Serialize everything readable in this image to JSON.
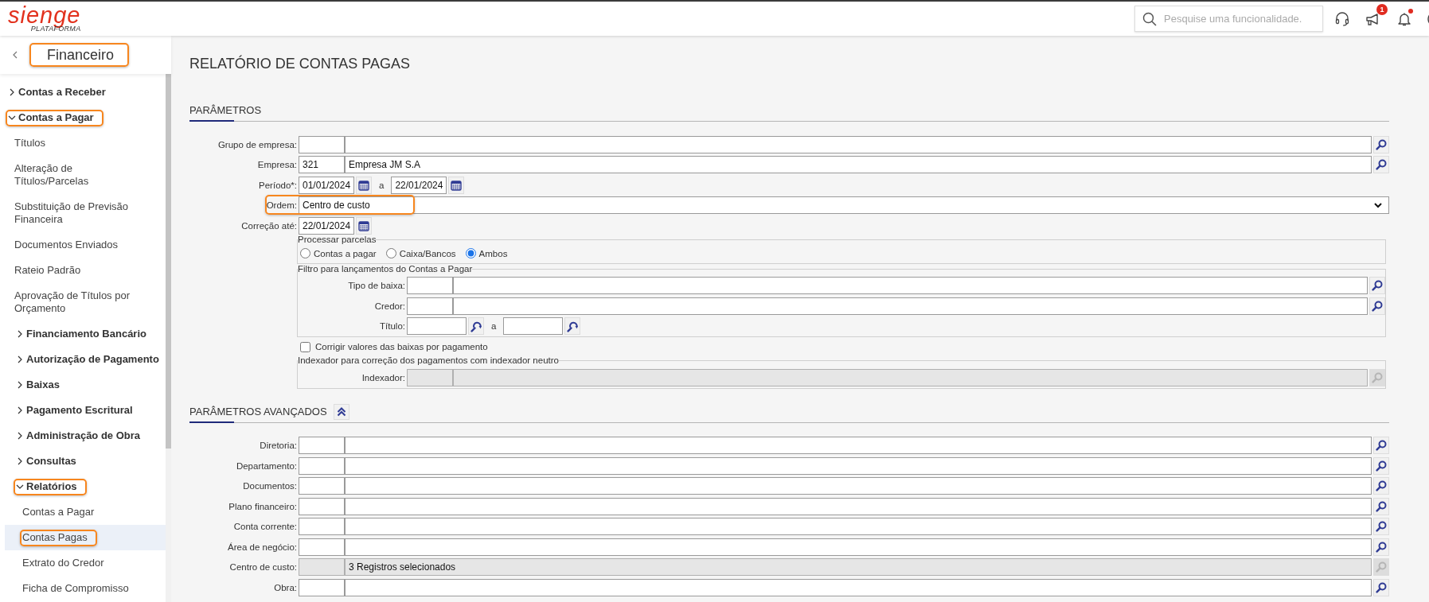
{
  "header": {
    "logo": "sienge",
    "logo_subtitle": "PLATAFORMA",
    "search": {
      "placeholder": "Pesquise uma funcionalidade."
    },
    "announcements_badge": "1",
    "unread_notifications": true
  },
  "sidebar": {
    "title": "Financeiro",
    "title_highlighted": true,
    "items": [
      {
        "label": "Contas a Receber",
        "kind": "group",
        "expanded": false,
        "selected": false,
        "highlighted": false
      },
      {
        "label": "Contas a Pagar",
        "kind": "group",
        "expanded": true,
        "selected": false,
        "highlighted": true,
        "children": [
          {
            "label": "Títulos",
            "kind": "link",
            "selected": false,
            "highlighted": false
          },
          {
            "label": "Alteração de Títulos/Parcelas",
            "kind": "link",
            "selected": false,
            "highlighted": false
          },
          {
            "label": "Substituição de Previsão Financeira",
            "kind": "link",
            "selected": false,
            "highlighted": false
          },
          {
            "label": "Documentos Enviados",
            "kind": "link",
            "selected": false,
            "highlighted": false
          },
          {
            "label": "Rateio Padrão",
            "kind": "link",
            "selected": false,
            "highlighted": false
          },
          {
            "label": "Aprovação de Títulos por Orçamento",
            "kind": "link",
            "selected": false,
            "highlighted": false
          },
          {
            "label": "Financiamento Bancário",
            "kind": "group",
            "expanded": false,
            "selected": false,
            "highlighted": false
          },
          {
            "label": "Autorização de Pagamento",
            "kind": "group",
            "expanded": false,
            "selected": false,
            "highlighted": false
          },
          {
            "label": "Baixas",
            "kind": "group",
            "expanded": false,
            "selected": false,
            "highlighted": false
          },
          {
            "label": "Pagamento Escritural",
            "kind": "group",
            "expanded": false,
            "selected": false,
            "highlighted": false
          },
          {
            "label": "Administração de Obra",
            "kind": "group",
            "expanded": false,
            "selected": false,
            "highlighted": false
          },
          {
            "label": "Consultas",
            "kind": "group",
            "expanded": false,
            "selected": false,
            "highlighted": false
          },
          {
            "label": "Relatórios",
            "kind": "group",
            "expanded": true,
            "selected": false,
            "highlighted": true,
            "children": [
              {
                "label": "Contas a Pagar",
                "kind": "link",
                "selected": false,
                "highlighted": false
              },
              {
                "label": "Contas Pagas",
                "kind": "link",
                "selected": true,
                "highlighted": true
              },
              {
                "label": "Extrato do Credor",
                "kind": "link",
                "selected": false,
                "highlighted": false
              },
              {
                "label": "Ficha de Compromisso",
                "kind": "link",
                "selected": false,
                "highlighted": false
              }
            ]
          }
        ]
      }
    ]
  },
  "page_title": "RELATÓRIO DE CONTAS PAGAS",
  "parameters": {
    "title": "PARÂMETROS",
    "items": [
      {
        "kind": "lookup",
        "label": "Grupo de empresa:",
        "disabled": false
      },
      {
        "kind": "lookup",
        "label": "Empresa:",
        "code": "321",
        "description": "Empresa JM S.A",
        "disabled": false
      },
      {
        "kind": "date_range",
        "label": "Período*:",
        "from": "01/01/2024",
        "separator": "a",
        "to": "22/01/2024"
      },
      {
        "kind": "select",
        "label": "Ordem:",
        "value": "Centro de custo",
        "highlighted": true
      },
      {
        "kind": "date",
        "label": "Correção até:",
        "value": "22/01/2024"
      },
      {
        "kind": "fieldset",
        "legend": "Processar parcelas",
        "items": [
          {
            "kind": "radios",
            "options": [
              {
                "label": "Contas a pagar",
                "selected": false
              },
              {
                "label": "Caixa/Bancos",
                "selected": false
              },
              {
                "label": "Ambos",
                "selected": true
              }
            ]
          }
        ]
      },
      {
        "kind": "fieldset",
        "legend": "Filtro para lançamentos do Contas a Pagar",
        "items": [
          {
            "kind": "lookup",
            "label": "Tipo de baixa:",
            "disabled": false
          },
          {
            "kind": "lookup",
            "label": "Credor:",
            "disabled": false
          },
          {
            "kind": "range",
            "label": "Título:",
            "separator": "a"
          }
        ]
      },
      {
        "kind": "checkbox",
        "label": "Corrigir valores das baixas por pagamento",
        "checked": false
      },
      {
        "kind": "fieldset",
        "legend": "Indexador para correção dos pagamentos com indexador neutro",
        "items": [
          {
            "kind": "lookup",
            "label": "Indexador:",
            "disabled": true
          }
        ]
      }
    ]
  },
  "advanced_parameters": {
    "title": "PARÂMETROS AVANÇADOS",
    "expanded": true,
    "items": [
      {
        "kind": "lookup",
        "label": "Diretoria:",
        "disabled": false
      },
      {
        "kind": "lookup",
        "label": "Departamento:",
        "disabled": false
      },
      {
        "kind": "lookup",
        "label": "Documentos:",
        "disabled": false
      },
      {
        "kind": "lookup",
        "label": "Plano financeiro:",
        "disabled": false
      },
      {
        "kind": "lookup",
        "label": "Conta corrente:",
        "disabled": false
      },
      {
        "kind": "lookup",
        "label": "Área de negócio:",
        "disabled": false
      },
      {
        "kind": "lookup",
        "label": "Centro de custo:",
        "description": "3 Registros selecionados",
        "disabled": true
      },
      {
        "kind": "lookup",
        "label": "Obra:",
        "disabled": false
      }
    ]
  }
}
